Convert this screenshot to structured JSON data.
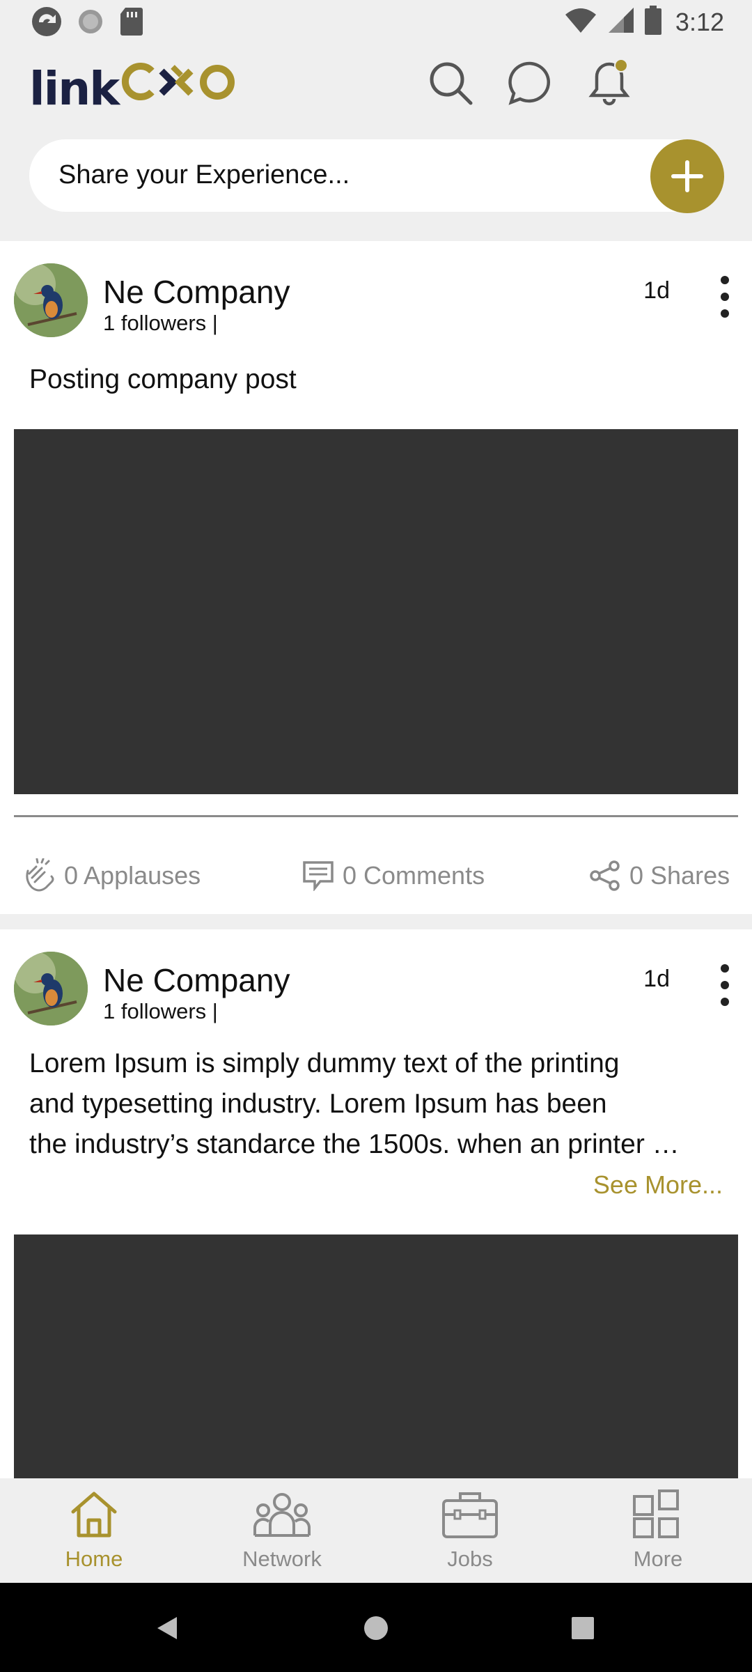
{
  "status_bar": {
    "time": "3:12",
    "left_icons": [
      "app-sync-icon",
      "circle-icon",
      "sd-card-icon"
    ],
    "right_icons": [
      "wifi-icon",
      "signal-icon",
      "battery-icon"
    ]
  },
  "header": {
    "logo_link": "link",
    "logo_cxo": "CXO",
    "icons": [
      "search-icon",
      "chat-icon",
      "notification-bell-icon"
    ]
  },
  "share": {
    "placeholder": "Share your Experience...",
    "add_icon": "plus-icon"
  },
  "posts": [
    {
      "company": "Ne Company",
      "followers": "1 followers |",
      "time": "1d",
      "text": "Posting company post",
      "applauses": "0 Applauses",
      "comments": "0 Comments",
      "shares": "0 Shares"
    },
    {
      "company": "Ne Company",
      "followers": "1 followers |",
      "time": "1d",
      "text_lines": [
        "Lorem Ipsum is simply dummy text of the printing",
        "and typesetting industry. Lorem Ipsum has been",
        "the industry’s standarce the 1500s. when an printer …"
      ],
      "see_more": "See More..."
    }
  ],
  "bottom_nav": {
    "items": [
      {
        "label": "Home",
        "icon": "home-icon",
        "active": true
      },
      {
        "label": "Network",
        "icon": "network-icon",
        "active": false
      },
      {
        "label": "Jobs",
        "icon": "briefcase-icon",
        "active": false
      },
      {
        "label": "More",
        "icon": "grid-icon",
        "active": false
      }
    ]
  },
  "colors": {
    "accent": "#a8922e",
    "navy": "#1b2142",
    "media_placeholder": "#333333",
    "muted": "#8a8a8a"
  }
}
